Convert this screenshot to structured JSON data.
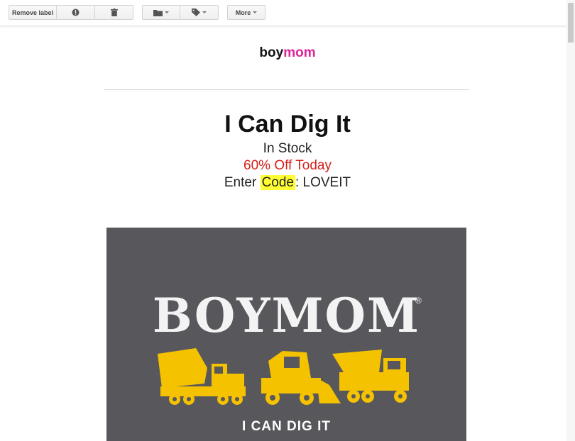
{
  "toolbar": {
    "remove_label": "Remove label",
    "more_label": "More",
    "icons": [
      "report-spam-icon",
      "delete-icon",
      "move-to-folder-icon",
      "labels-icon"
    ]
  },
  "email": {
    "brand_part1": "boy",
    "brand_part2": "mom",
    "title": "I Can Dig It",
    "stock": "In Stock",
    "discount": "60% Off Today",
    "code_prefix": "Enter ",
    "code_word": "Code",
    "code_suffix": ": LOVEIT",
    "banner_logo": "BOYMOM",
    "banner_reg": "®",
    "banner_tagline": "I CAN DIG IT"
  },
  "colors": {
    "brand_pink": "#e0249a",
    "discount_red": "#d4201a",
    "highlight_yellow": "#ffff33",
    "banner_gray": "#58585c",
    "truck_yellow": "#f5c200"
  }
}
